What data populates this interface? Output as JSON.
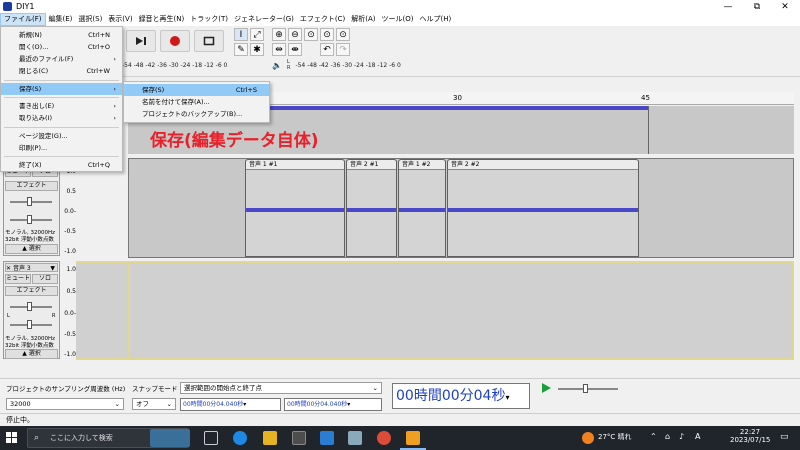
{
  "window": {
    "title": "DIY1"
  },
  "window_controls": {
    "minimize": "—",
    "maximize": "⧉",
    "close": "✕"
  },
  "menubar": {
    "items": [
      "ファイル(F)",
      "編集(E)",
      "選択(S)",
      "表示(V)",
      "録音と再生(N)",
      "トラック(T)",
      "ジェネレーター(G)",
      "エフェクト(C)",
      "解析(A)",
      "ツール(O)",
      "ヘルプ(H)"
    ]
  },
  "meters": {
    "record_ticks": "-54  -48  -42  -36  -30  -24  -18  -12   -6    0",
    "playback_label_l": "L",
    "playback_label_r": "R",
    "playback_ticks": "-54  -48  -42  -36  -30  -24  -18  -12   -6    0"
  },
  "ruler": {
    "ticks": [
      "30",
      "45"
    ]
  },
  "file_menu": {
    "items": [
      {
        "label": "新規(N)",
        "shortcut": "Ctrl+N"
      },
      {
        "label": "開く(O)...",
        "shortcut": "Ctrl+O"
      },
      {
        "label": "最近のファイル(F)",
        "shortcut": ""
      },
      {
        "label": "閉じる(C)",
        "shortcut": "Ctrl+W"
      },
      {
        "label": "保存(S)",
        "shortcut": ""
      },
      {
        "label": "書き出し(E)",
        "shortcut": ""
      },
      {
        "label": "取り込み(I)",
        "shortcut": ""
      },
      {
        "label": "ページ設定(G)...",
        "shortcut": ""
      },
      {
        "label": "印刷(P)...",
        "shortcut": ""
      },
      {
        "label": "終了(X)",
        "shortcut": "Ctrl+Q"
      }
    ]
  },
  "save_submenu": {
    "items": [
      {
        "label": "保存(S)",
        "shortcut": "Ctrl+S"
      },
      {
        "label": "名前を付けて保存(A)...",
        "shortcut": ""
      },
      {
        "label": "プロジェクトのバックアップ(B)...",
        "shortcut": ""
      }
    ]
  },
  "annotation": "保存(編集データ自体)",
  "tracks": [
    {
      "mute": "ミュート",
      "solo": "ソロ",
      "effects": "エフェクト",
      "info1": "モノラル, 32000Hz",
      "info2": "32bit 浮動小数点数",
      "select": "選択",
      "yscale": [
        "1.0",
        "0.5",
        "0.0-",
        "-0.5",
        "-1.0"
      ],
      "clips": [
        "音声 1 #1",
        "音声 2 #1",
        "音声 1 #2",
        "音声 2 #2"
      ]
    },
    {
      "name": "音声 3",
      "mute": "ミュート",
      "solo": "ソロ",
      "effects": "エフェクト",
      "l": "L",
      "r": "R",
      "info1": "モノラル, 32000Hz",
      "info2": "32bit 浮動小数点数",
      "select": "選択",
      "yscale": [
        "1.0",
        "0.5",
        "0.0-",
        "-0.5",
        "-1.0"
      ]
    }
  ],
  "selection_bar": {
    "rate_label": "プロジェクトのサンプリング周波数 (Hz)",
    "rate_value": "32000",
    "snap_label": "スナップモード",
    "snap_value": "オフ",
    "range_label": "選択範囲の開始点と終了点",
    "start_time": "00時間00分04.040秒",
    "end_time": "00時間00分04.040秒",
    "big_time": "00時間00分04秒"
  },
  "status": "停止中。",
  "taskbar": {
    "search_placeholder": "ここに入力して検索",
    "weather": "27°C  晴れ",
    "ime": "A",
    "time": "22:27",
    "date": "2023/07/15"
  }
}
